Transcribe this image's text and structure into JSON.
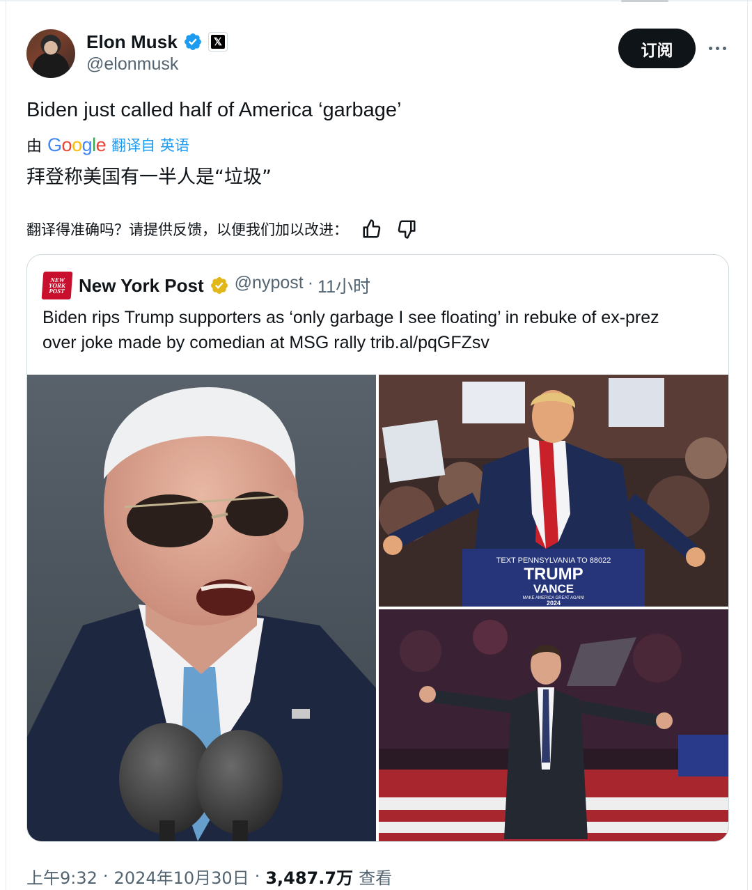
{
  "author": {
    "name": "Elon Musk",
    "handle": "@elonmusk",
    "badge_letter": "𝕏"
  },
  "subscribe_label": "订阅",
  "more_icon": "more-dots-icon",
  "tweet": {
    "text": "Biden just called half of America ‘garbage’",
    "translated_by": "由",
    "google_letters": [
      "G",
      "o",
      "o",
      "g",
      "l",
      "e"
    ],
    "translated_from": "翻译自 英语",
    "translation": "拜登称美国有一半人是“垃圾”",
    "feedback_prompt": "翻译得准确吗？请提供反馈，以便我们加以改进："
  },
  "quoted": {
    "logo_lines": [
      "NEW",
      "YORK",
      "POST"
    ],
    "name": "New York Post",
    "handle": "@nypost",
    "dot": "·",
    "time": "11小时",
    "text": "Biden rips Trump supporters as ‘only garbage I see floating’ in rebuke of ex-prez over joke made by comedian at MSG rally trib.al/pqGFZsv",
    "sign_line1": "TEXT PENNSYLVANIA TO 88022",
    "sign_line2": "TRUMP",
    "sign_line3": "VANCE",
    "sign_line4": "MAKE AMERICA GREAT AGAIN!",
    "sign_line5": "2024"
  },
  "footer": {
    "time": "上午9:32",
    "sep1": "·",
    "date": "2024年10月30日",
    "sep2": "·",
    "views": "3,487.7万",
    "views_label": "查看"
  },
  "colors": {
    "accent": "#1d9bf0",
    "verified_blue": "#1d9bf0",
    "verified_gold": "#e2b719",
    "nypost_red": "#c8102e"
  }
}
